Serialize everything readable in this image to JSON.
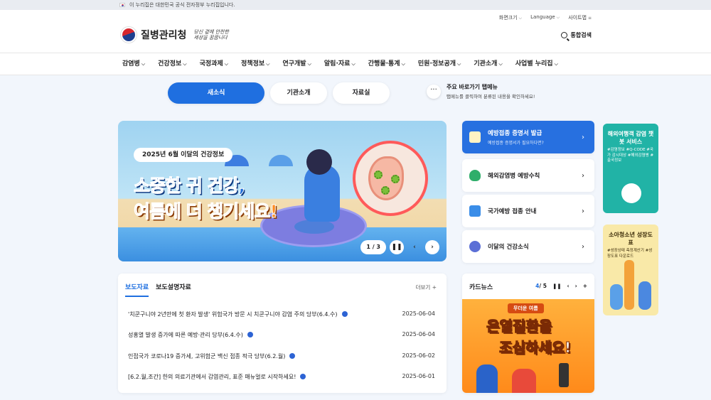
{
  "gov_notice": "이 누리집은 대한민국 공식 전자정부 누리집입니다.",
  "util": {
    "font_size": "화면크기",
    "language": "Language",
    "sitemap": "사이트맵"
  },
  "logo": {
    "name": "질병관리청",
    "slogan_line1": "당신 곁에 안전한",
    "slogan_line2": "세상을 꿈꿉니다"
  },
  "search_label": "통합검색",
  "gnb": [
    "감염병",
    "건강정보",
    "국정과제",
    "정책정보",
    "연구개발",
    "알림·자료",
    "간행물·통계",
    "민원·정보공개",
    "기관소개",
    "사업별 누리집"
  ],
  "tabs": [
    "새소식",
    "기관소개",
    "자료실"
  ],
  "quick": {
    "title": "주요 바로가기 탭메뉴",
    "desc": "탭메뉴를 클릭하여 분류된 내용을 확인하세요!"
  },
  "banner": {
    "tag": "2025년 6월 이달의 건강정보",
    "headline1": "소중한 귀 건강,",
    "headline2": "여름에 더 챙기세요!",
    "pager": "1 / 3"
  },
  "services": [
    {
      "label": "예방접종 증명서 발급",
      "sub": "예방접종 증명서가 필요하다면?"
    },
    {
      "label": "해외감염병 예방수칙",
      "sub": ""
    },
    {
      "label": "국가예방 접종 안내",
      "sub": ""
    },
    {
      "label": "이달의 건강소식",
      "sub": ""
    }
  ],
  "side_ads": [
    {
      "title": "해외여행객 감염 챗봇 서비스",
      "sub": "#감염정보 #Q-CODE #국가 감시대상 #해외감염병 #출국정보"
    },
    {
      "title": "소아청소년 성장도표",
      "sub": "#성장상태 측정계산기 #성장도표 다운로드"
    }
  ],
  "news": {
    "tab_active": "보도자료",
    "tab_other": "보도설명자료",
    "more": "더보기",
    "rows": [
      {
        "title": "'치쿤구니야 2년만에 첫 환자 발생' 위험국가 방문 시 치쿤구니야 감염 주의 당부(6.4.수)",
        "date": "2025-06-04"
      },
      {
        "title": "성홍열 발생 증가에 따른 예방·관리 당부(6.4.수)",
        "date": "2025-06-04"
      },
      {
        "title": "인접국가 코로나19 증가세, 고위험군 백신 접종 적극 당부(6.2.월)",
        "date": "2025-06-02"
      },
      {
        "title": "[6.2.월,조간] 한의 의료기관에서 감염관리, 표준 매뉴얼로 시작하세요!",
        "date": "2025-06-01"
      }
    ]
  },
  "card_news": {
    "title": "카드뉴스",
    "current": "4",
    "total": "/ 5",
    "tag": "무더운 여름",
    "line1": "온열질환을",
    "line2": "조심하세요!"
  }
}
